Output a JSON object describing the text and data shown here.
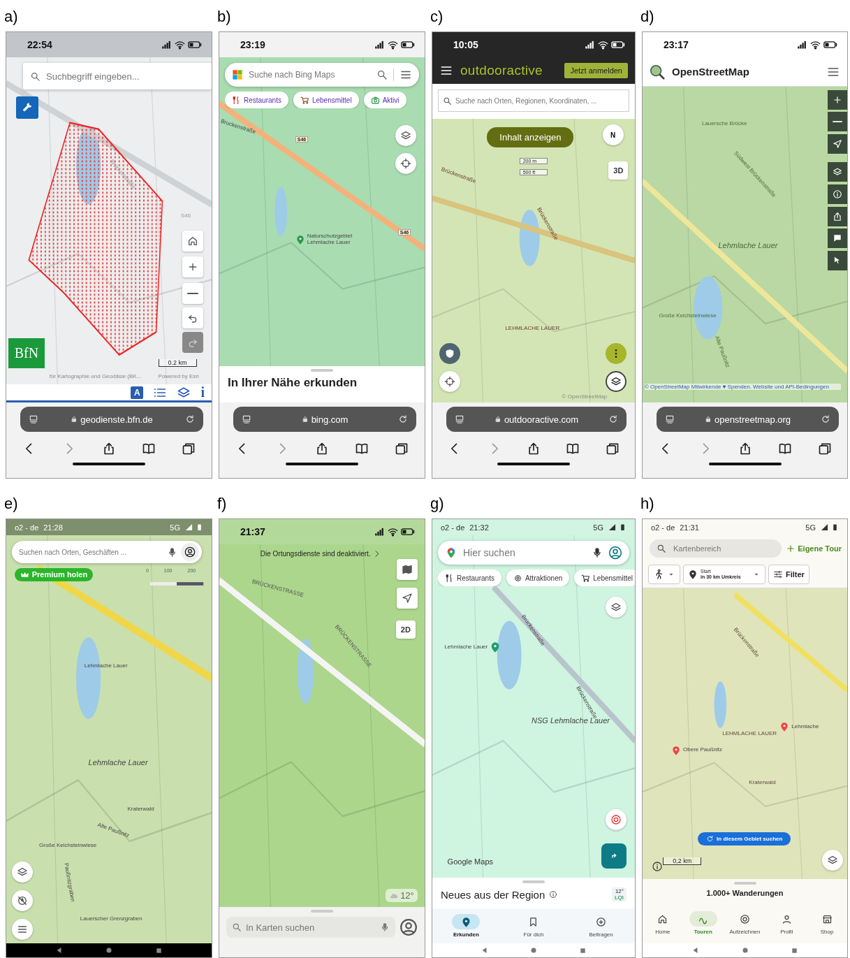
{
  "panels": [
    {
      "label": "a)",
      "sections": [
        {
          "kind": "status",
          "time": "22:54"
        },
        {
          "kind": "map",
          "search": {
            "placeholder": "Suchbegriff eingeben..."
          },
          "items": [
            {
              "kind": "label",
              "text": "Brückenstraße"
            },
            {
              "kind": "label",
              "text": "S46"
            },
            {
              "kind": "scale",
              "text": "0.2 km"
            },
            {
              "kind": "logo",
              "text": "BfN"
            },
            {
              "kind": "attribution",
              "text": "für Kartographie und Geodäsie (BK..."
            },
            {
              "kind": "attribution",
              "text": "Powered by Esri"
            }
          ]
        },
        {
          "kind": "iconbar",
          "keys": [
            "A",
            "i"
          ]
        },
        {
          "kind": "urlbar",
          "url": "geodienste.bfn.de"
        },
        {
          "kind": "browser-toolbar"
        }
      ]
    },
    {
      "label": "b)",
      "sections": [
        {
          "kind": "status",
          "time": "23:19"
        },
        {
          "kind": "map",
          "search": {
            "placeholder": "Suche nach Bing Maps"
          },
          "chips": [
            "Restaurants",
            "Lebensmittel",
            "Aktivi"
          ],
          "items": [
            {
              "kind": "label",
              "text": "Bruckenstraße"
            },
            {
              "kind": "shield",
              "text": "S46"
            },
            {
              "kind": "shield",
              "text": "S46"
            },
            {
              "kind": "poi",
              "text": "Naturschutzgebiet Lehmlache Lauer"
            }
          ]
        },
        {
          "kind": "sheet",
          "title": "In Ihrer Nähe erkunden"
        },
        {
          "kind": "urlbar",
          "url": "bing.com"
        },
        {
          "kind": "browser-toolbar"
        }
      ]
    },
    {
      "label": "c)",
      "sections": [
        {
          "kind": "status",
          "time": "10:05"
        },
        {
          "kind": "brandbar",
          "title": "outdooractive",
          "button": "Jetzt anmelden"
        },
        {
          "kind": "search",
          "placeholder": "Suche nach Orten, Regionen, Koordinaten, ..."
        },
        {
          "kind": "map",
          "items": [
            {
              "kind": "button",
              "text": "Inhalt anzeigen"
            },
            {
              "kind": "compass",
              "text": "N"
            },
            {
              "kind": "scalebox",
              "text": "200 m"
            },
            {
              "kind": "scalebox",
              "text": "500 ft"
            },
            {
              "kind": "badge",
              "text": "3D"
            },
            {
              "kind": "label",
              "text": "Brückenstraße"
            },
            {
              "kind": "label",
              "text": "Brückenstraße"
            },
            {
              "kind": "label",
              "text": "LEHMLACHE LAUER"
            },
            {
              "kind": "attribution",
              "text": "© OpenStreetMap"
            }
          ]
        },
        {
          "kind": "urlbar",
          "url": "outdooractive.com"
        },
        {
          "kind": "browser-toolbar"
        }
      ]
    },
    {
      "label": "d)",
      "sections": [
        {
          "kind": "status",
          "time": "23:17"
        },
        {
          "kind": "brandbar",
          "title": "OpenStreetMap"
        },
        {
          "kind": "map",
          "items": [
            {
              "kind": "label",
              "text": "Lauersche Brücke"
            },
            {
              "kind": "label",
              "text": "Südwest Brückenstraße"
            },
            {
              "kind": "title",
              "text": "Lehmlache Lauer"
            },
            {
              "kind": "label",
              "text": "Große Kelchsteinwiese"
            },
            {
              "kind": "label",
              "text": "Alte Paußnitz"
            },
            {
              "kind": "attribution",
              "text": "© OpenStreetMap Mitwirkende ♥ Spenden. Website und API-Bedingungen"
            }
          ]
        },
        {
          "kind": "urlbar",
          "url": "openstreetmap.org"
        },
        {
          "kind": "browser-toolbar"
        }
      ]
    },
    {
      "label": "e)",
      "sections": [
        {
          "kind": "status",
          "carrier": "o2 - de",
          "time": "21:28",
          "network": "5G"
        },
        {
          "kind": "map",
          "search": {
            "placeholder": "Suchen nach Orten, Geschäften ..."
          },
          "items": [
            {
              "kind": "button",
              "text": "Premium holen"
            },
            {
              "kind": "ticks",
              "ticks": [
                "0",
                "100",
                "200"
              ]
            },
            {
              "kind": "label",
              "text": "Lehmlache Lauer"
            },
            {
              "kind": "title",
              "text": "Lehmlache Lauer"
            },
            {
              "kind": "label",
              "text": "Kraterwald"
            },
            {
              "kind": "label",
              "text": "Alte Paußnitz"
            },
            {
              "kind": "label",
              "text": "Große Kelchsteinwiese"
            },
            {
              "kind": "label",
              "text": "Paußnitzgraben"
            },
            {
              "kind": "label",
              "text": "Lauerscher Grenzgraben"
            }
          ]
        },
        {
          "kind": "android-nav"
        }
      ]
    },
    {
      "label": "f)",
      "sections": [
        {
          "kind": "status",
          "time": "21:37"
        },
        {
          "kind": "map",
          "items": [
            {
              "kind": "notice",
              "text": "Die Ortungsdienste sind deaktiviert."
            },
            {
              "kind": "label",
              "text": "BRÜCKENSTRASSE"
            },
            {
              "kind": "label",
              "text": "BRÜCKENSTRASSE"
            },
            {
              "kind": "badge",
              "text": "2D"
            },
            {
              "kind": "weather",
              "text": "12°"
            }
          ]
        },
        {
          "kind": "sheet-search",
          "placeholder": "In Karten suchen"
        }
      ]
    },
    {
      "label": "g)",
      "sections": [
        {
          "kind": "status",
          "carrier": "o2 - de",
          "time": "21:32",
          "network": "5G"
        },
        {
          "kind": "map",
          "search": {
            "placeholder": "Hier suchen"
          },
          "chips": [
            "Restaurants",
            "Attraktionen",
            "Lebensmittel"
          ],
          "items": [
            {
              "kind": "poi",
              "text": "Lehmlache Lauer"
            },
            {
              "kind": "label",
              "text": "Brückenstraße"
            },
            {
              "kind": "label",
              "text": "Brückenstraße"
            },
            {
              "kind": "title",
              "text": "NSG Lehmlache Lauer"
            },
            {
              "kind": "brand",
              "text": "Google Maps"
            }
          ]
        },
        {
          "kind": "sheet",
          "title": "Neues aus der Region",
          "weather": "12°",
          "air": "LQI"
        },
        {
          "kind": "tabbar",
          "items": [
            {
              "label": "Erkunden",
              "selected": true
            },
            {
              "label": "Für dich",
              "selected": false
            },
            {
              "label": "Beitragen",
              "selected": false
            }
          ]
        },
        {
          "kind": "android-nav"
        }
      ]
    },
    {
      "label": "h)",
      "sections": [
        {
          "kind": "status",
          "carrier": "o2 - de",
          "time": "21:31",
          "network": "5G"
        },
        {
          "kind": "search",
          "placeholder": "Kartenbereich",
          "action": "Eigene Tour"
        },
        {
          "kind": "filters",
          "start": "Start",
          "radius": "in 30 km Umkreis",
          "filter": "Filter"
        },
        {
          "kind": "map",
          "items": [
            {
              "kind": "label",
              "text": "Brückenstraße"
            },
            {
              "kind": "label",
              "text": "LEHMLACHE LAUER"
            },
            {
              "kind": "poi",
              "text": "Lehmlache"
            },
            {
              "kind": "poi",
              "text": "Obere Paußnitz"
            },
            {
              "kind": "label",
              "text": "Kraterwald"
            },
            {
              "kind": "button",
              "text": "In diesem Gebiet suchen"
            },
            {
              "kind": "scale",
              "text": "0,2 km"
            }
          ]
        },
        {
          "kind": "sheet",
          "title": "1.000+ Wanderungen"
        },
        {
          "kind": "tabbar",
          "items": [
            {
              "label": "Home",
              "selected": false
            },
            {
              "label": "Touren",
              "selected": true
            },
            {
              "label": "Aufzeichnen",
              "selected": false
            },
            {
              "label": "Profil",
              "selected": false
            },
            {
              "label": "Shop",
              "selected": false
            }
          ]
        },
        {
          "kind": "android-nav"
        }
      ]
    }
  ]
}
